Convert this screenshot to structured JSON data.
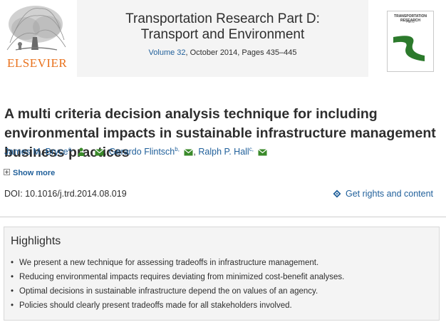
{
  "publisher": {
    "name": "ELSEVIER",
    "logo_icon": "elsevier-tree-icon"
  },
  "journal": {
    "title": "Transportation Research Part D: Transport and Environment",
    "volume_link": "Volume 32",
    "issue_info": ", October 2014, Pages 435–445",
    "cover_title": "TRANSPORTATION RESEARCH",
    "cover_part": "Part D"
  },
  "article": {
    "title": "A multi criteria decision analysis technique for including environmental impacts in sustainable infrastructure management business practices",
    "authors": [
      {
        "name": "James M. Bryce",
        "sup": "a,",
        "icons": [
          "person-icon",
          "mail-icon"
        ]
      },
      {
        "name": "Gerardo Flintsch",
        "sup": "b,",
        "icons": [
          "mail-icon"
        ]
      },
      {
        "name": "Ralph P. Hall",
        "sup": "c,",
        "icons": [
          "mail-icon"
        ]
      }
    ],
    "show_more": "Show more",
    "doi": "DOI: 10.1016/j.trd.2014.08.019",
    "rights": "Get rights and content"
  },
  "highlights": {
    "title": "Highlights",
    "items": [
      "We present a new technique for assessing tradeoffs in infrastructure management.",
      "Reducing environmental impacts requires deviating from minimized cost-benefit analyses.",
      "Optimal decisions in sustainable infrastructure depend the on values of an agency.",
      "Policies should clearly present tradeoffs made for all stakeholders involved."
    ]
  },
  "colors": {
    "link": "#1f5f9a",
    "accent_orange": "#e9711c",
    "cover_green": "#2c7a2c",
    "icon_green": "#3a8a2a"
  }
}
